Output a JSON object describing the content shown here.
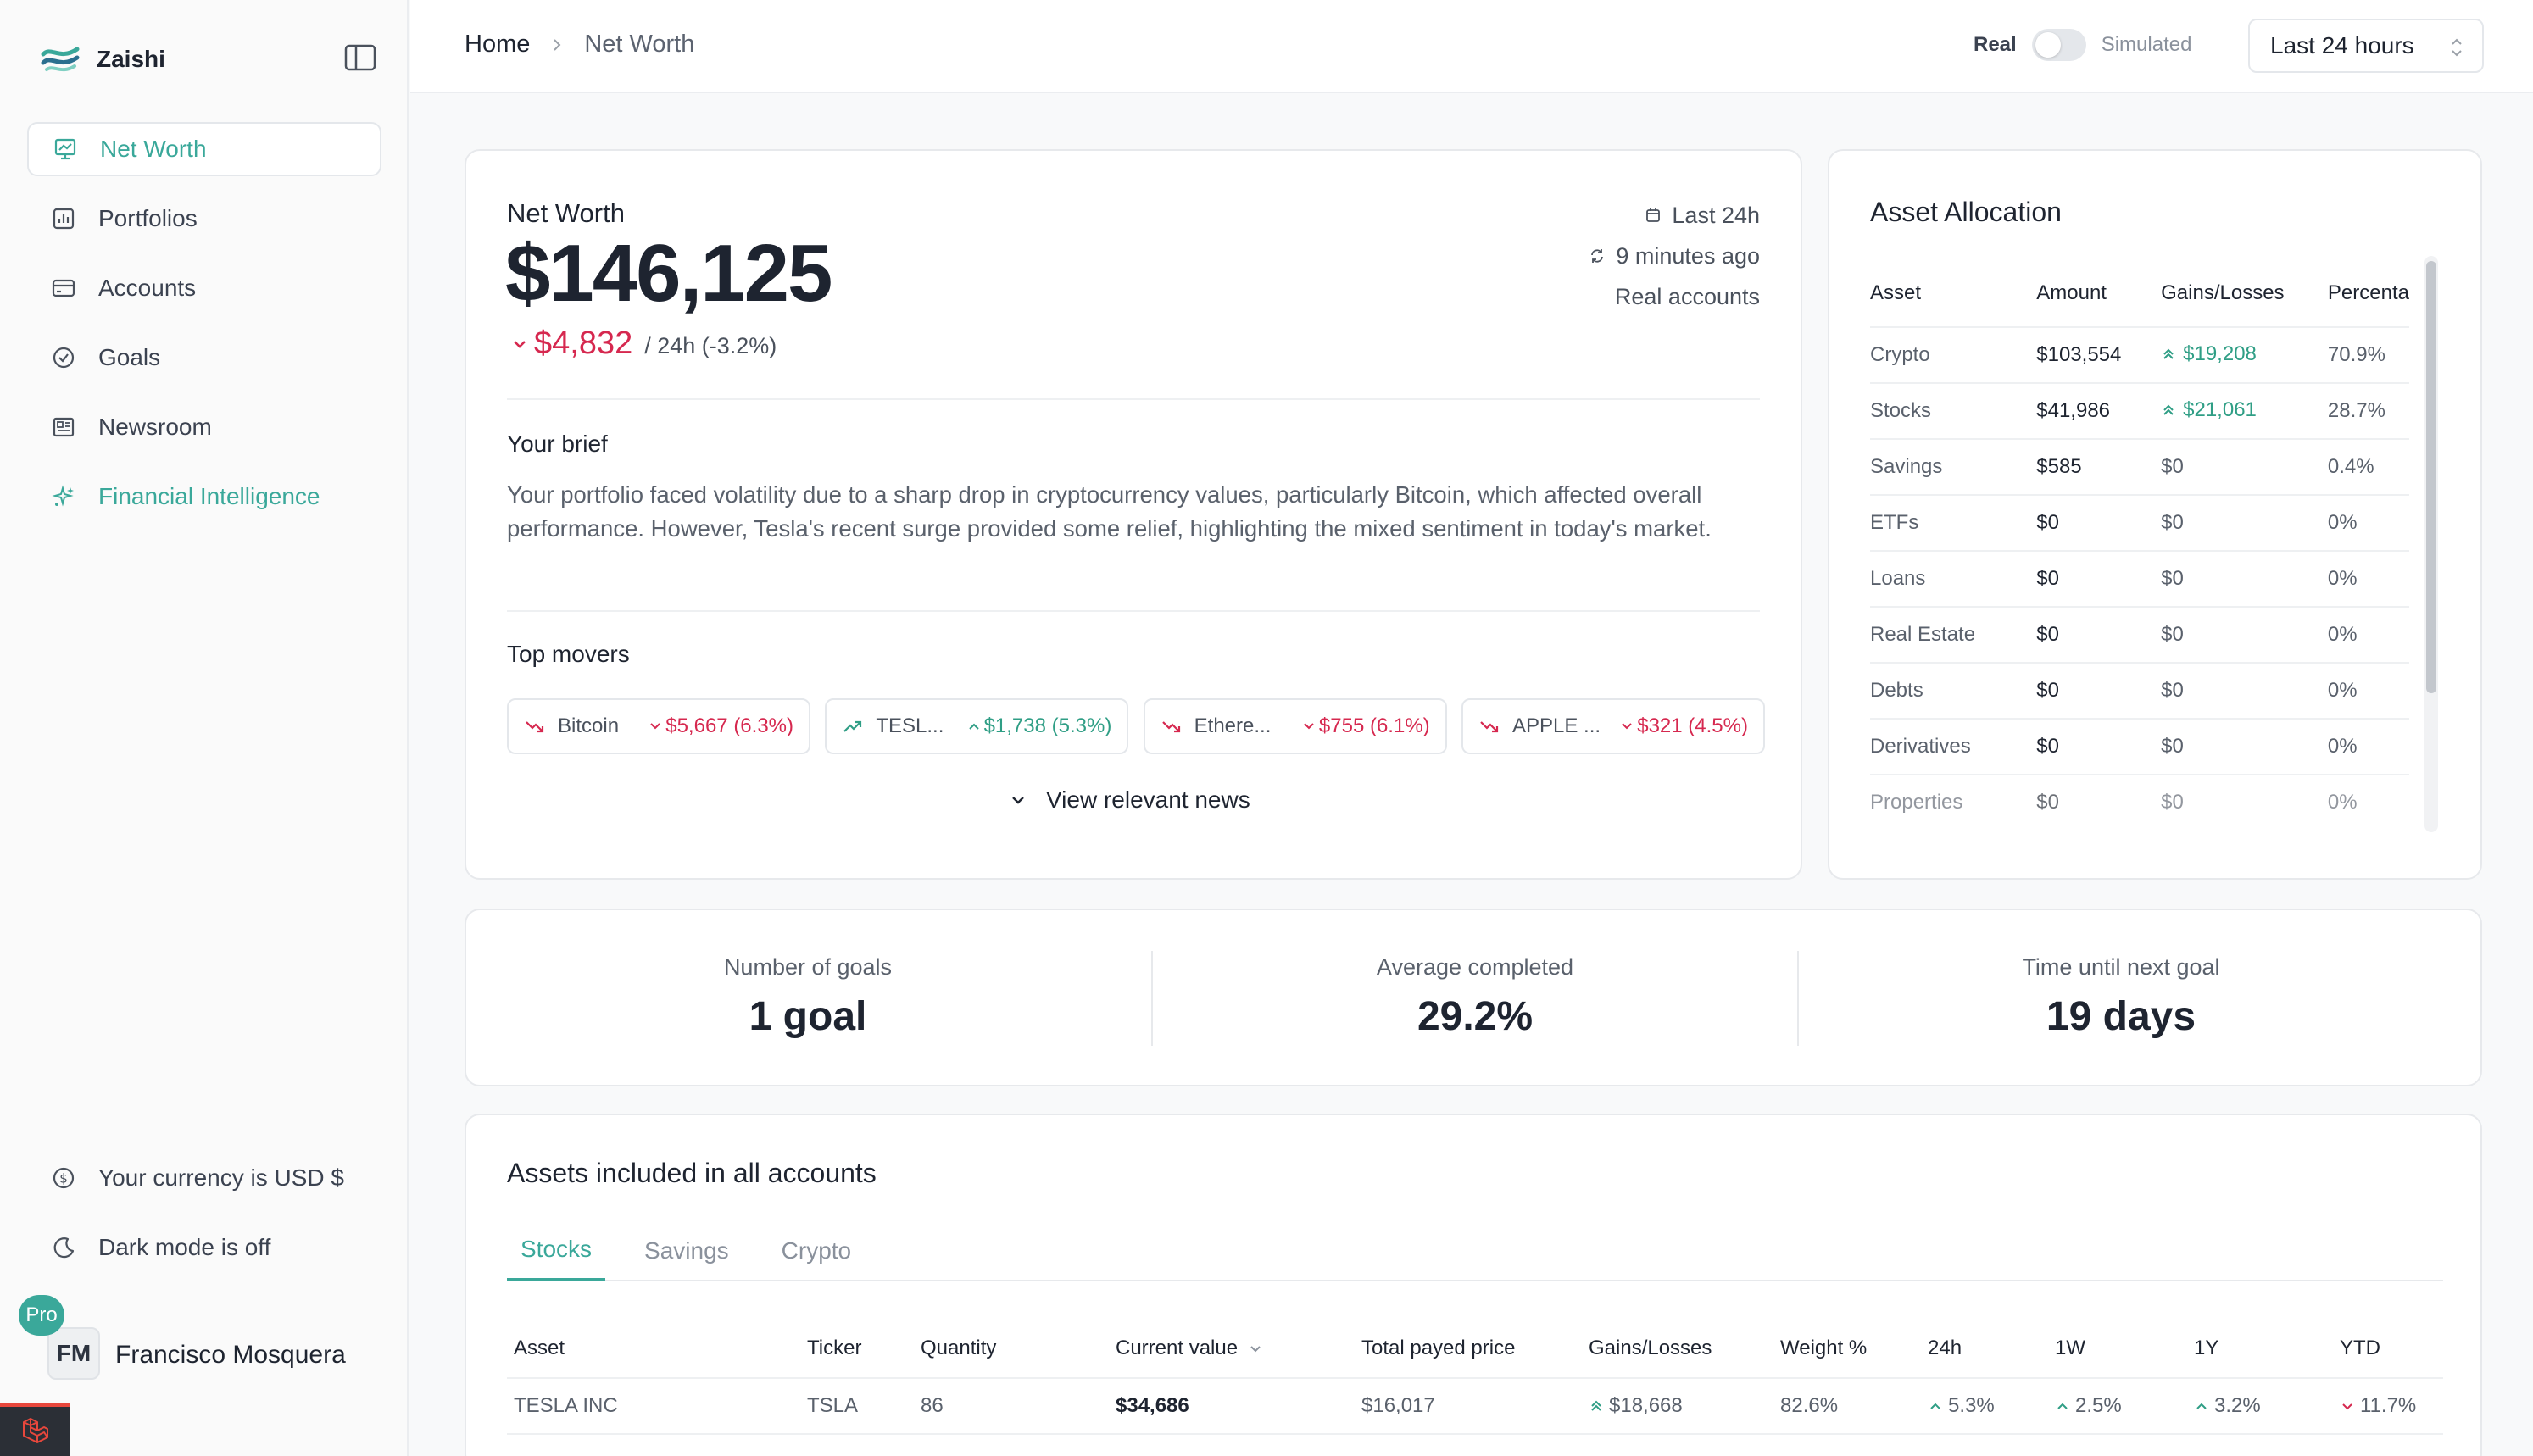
{
  "app": {
    "name": "Zaishi"
  },
  "colors": {
    "accent": "#3aa89a",
    "negative": "#d6284f",
    "positive": "#2f9e85",
    "pro_badge": "#3aa89a"
  },
  "sidebar": {
    "items": [
      {
        "label": "Net Worth",
        "icon": "net-worth-icon",
        "active": true
      },
      {
        "label": "Portfolios",
        "icon": "chart-bar-icon"
      },
      {
        "label": "Accounts",
        "icon": "credit-card-icon"
      },
      {
        "label": "Goals",
        "icon": "check-circle-icon"
      },
      {
        "label": "Newsroom",
        "icon": "newspaper-icon"
      },
      {
        "label": "Financial Intelligence",
        "icon": "sparkles-icon",
        "highlight": true
      }
    ],
    "currency_label": "Your currency is USD $",
    "dark_mode_label": "Dark mode is off",
    "user": {
      "initials": "FM",
      "name": "Francisco Mosquera",
      "badge": "Pro"
    }
  },
  "header": {
    "breadcrumb": {
      "home": "Home",
      "current": "Net Worth"
    },
    "mode": {
      "real": "Real",
      "simulated": "Simulated"
    },
    "period": "Last 24 hours"
  },
  "networth": {
    "label": "Net Worth",
    "value": "$146,125",
    "change_amount": "$4,832",
    "change_period": "/ 24h (-3.2%)",
    "meta": {
      "period": "Last 24h",
      "updated": "9 minutes ago",
      "source": "Real accounts"
    },
    "brief_title": "Your brief",
    "brief_text": "Your portfolio faced volatility due to a sharp drop in cryptocurrency values, particularly Bitcoin, which affected overall performance. However, Tesla's recent surge provided some relief, highlighting the mixed sentiment in today's market.",
    "movers_title": "Top movers",
    "movers": [
      {
        "name": "Bitcoin",
        "value": "$5,667",
        "pct": "(6.3%)",
        "direction": "down"
      },
      {
        "name": "TESL...",
        "value": "$1,738",
        "pct": "(5.3%)",
        "direction": "up"
      },
      {
        "name": "Ethere...",
        "value": "$755",
        "pct": "(6.1%)",
        "direction": "down"
      },
      {
        "name": "APPLE ...",
        "value": "$321",
        "pct": "(4.5%)",
        "direction": "down"
      }
    ],
    "news_button": "View relevant news"
  },
  "allocation": {
    "title": "Asset Allocation",
    "columns": [
      "Asset",
      "Amount",
      "Gains/Losses",
      "Percenta"
    ],
    "rows": [
      {
        "asset": "Crypto",
        "amount": "$103,554",
        "gain": "$19,208",
        "gain_up": true,
        "pct": "70.9%"
      },
      {
        "asset": "Stocks",
        "amount": "$41,986",
        "gain": "$21,061",
        "gain_up": true,
        "pct": "28.7%"
      },
      {
        "asset": "Savings",
        "amount": "$585",
        "gain": "$0",
        "pct": "0.4%"
      },
      {
        "asset": "ETFs",
        "amount": "$0",
        "gain": "$0",
        "pct": "0%"
      },
      {
        "asset": "Loans",
        "amount": "$0",
        "gain": "$0",
        "pct": "0%"
      },
      {
        "asset": "Real Estate",
        "amount": "$0",
        "gain": "$0",
        "pct": "0%"
      },
      {
        "asset": "Debts",
        "amount": "$0",
        "gain": "$0",
        "pct": "0%"
      },
      {
        "asset": "Derivatives",
        "amount": "$0",
        "gain": "$0",
        "pct": "0%"
      },
      {
        "asset": "Properties",
        "amount": "$0",
        "gain": "$0",
        "pct": "0%"
      }
    ]
  },
  "goals": [
    {
      "label": "Number of goals",
      "value": "1 goal"
    },
    {
      "label": "Average completed",
      "value": "29.2%"
    },
    {
      "label": "Time until next goal",
      "value": "19 days"
    }
  ],
  "assets": {
    "title": "Assets included in all accounts",
    "tabs": [
      "Stocks",
      "Savings",
      "Crypto"
    ],
    "columns": [
      "Asset",
      "Ticker",
      "Quantity",
      "Current value",
      "Total payed price",
      "Gains/Losses",
      "Weight %",
      "24h",
      "1W",
      "1Y",
      "YTD"
    ],
    "rows": [
      {
        "asset": "TESLA INC",
        "ticker": "TSLA",
        "quantity": "86",
        "current": "$34,686",
        "paid": "$16,017",
        "gain": "$18,668",
        "weight": "82.6%",
        "d24": "5.3%",
        "w1": "2.5%",
        "y1": "3.2%",
        "ytd": "11.7%"
      }
    ]
  }
}
